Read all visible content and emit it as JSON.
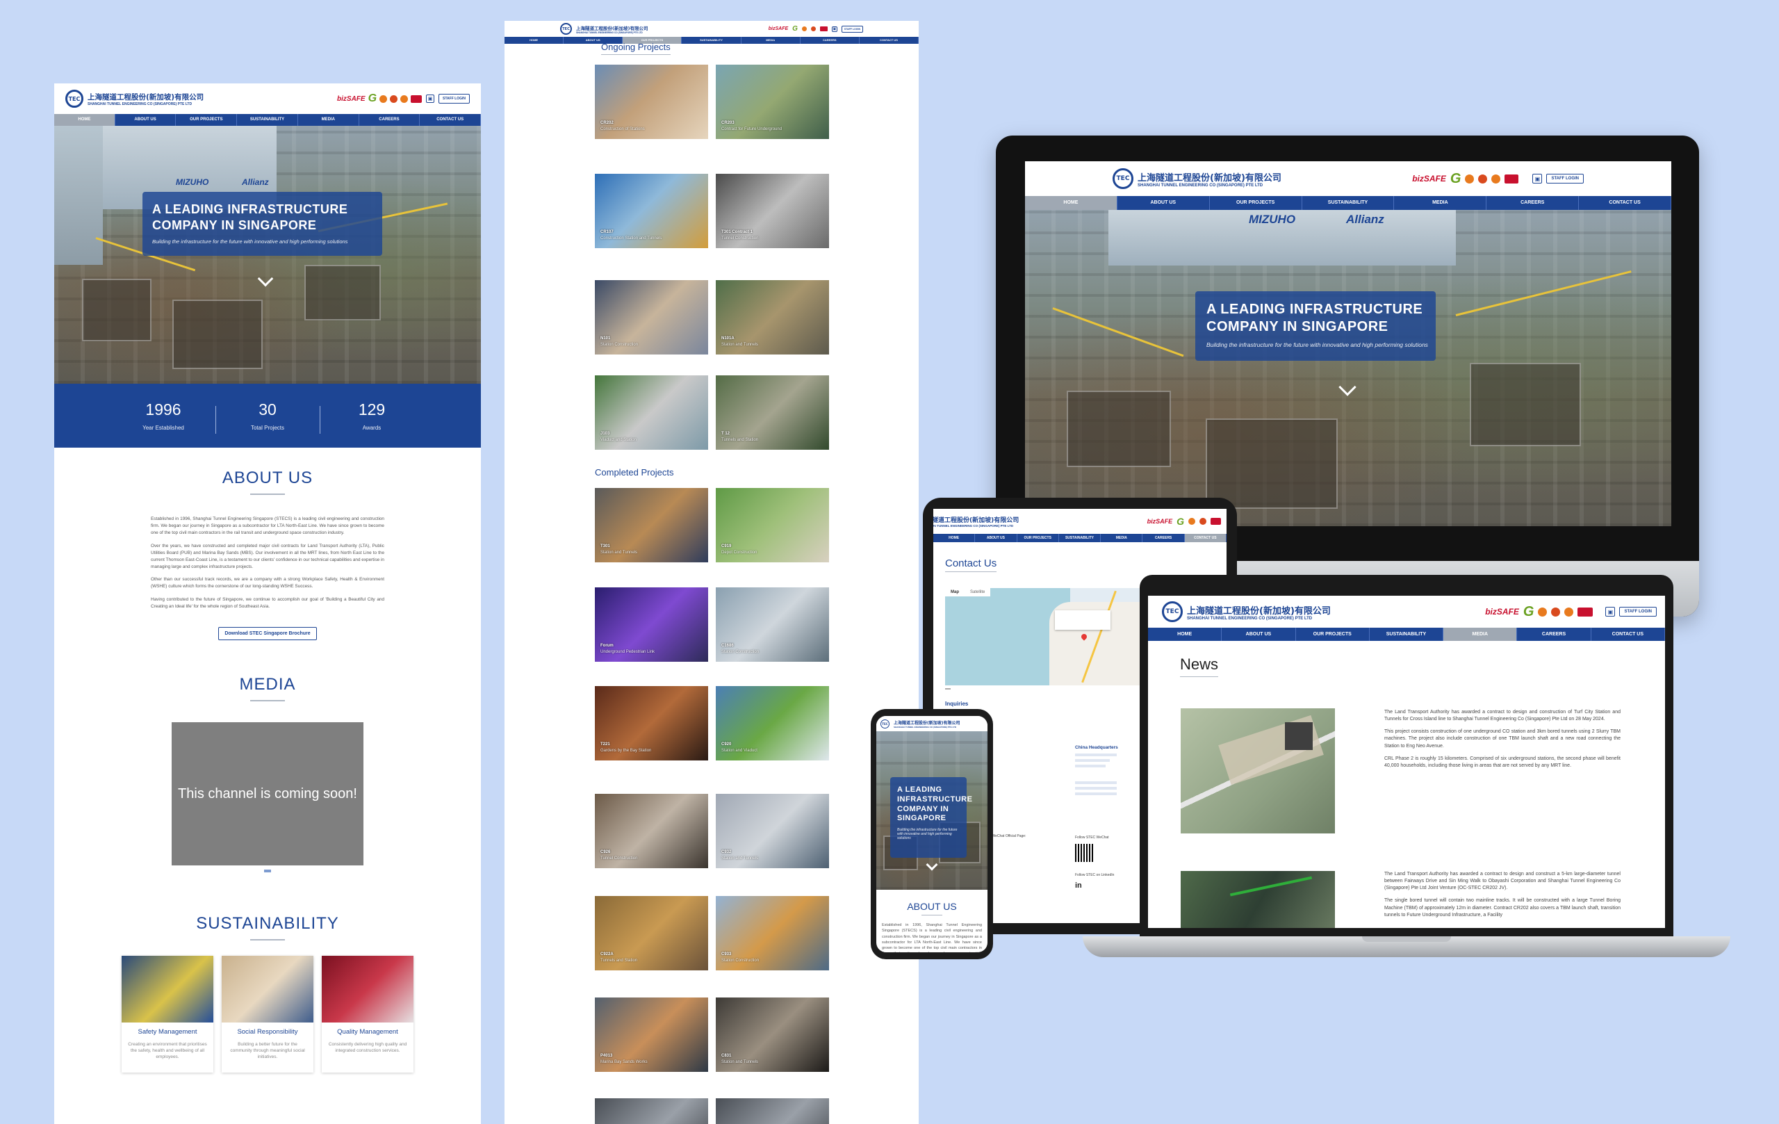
{
  "brand": {
    "logo_mark": "TEC",
    "name_cn": "上海隧道工程股份(新加坡)有限公司",
    "name_en": "SHANGHAI TUNNEL ENGINEERING CO (SINGAPORE) PTE LTD",
    "bizsafe": "bizSAFE",
    "staff_login": "STAFF LOGIN"
  },
  "nav": [
    "HOME",
    "ABOUT US",
    "OUR PROJECTS",
    "SUSTAINABILITY",
    "MEDIA",
    "CAREERS",
    "CONTACT US"
  ],
  "hero": {
    "title_line1": "A LEADING INFRASTRUCTURE",
    "title_line2": "COMPANY IN SINGAPORE",
    "subtitle": "Building the infrastructure for the future with innovative and high performing solutions",
    "signs": [
      "MIZUHO",
      "Allianz"
    ]
  },
  "stats": [
    {
      "value": "1996",
      "label": "Year Established"
    },
    {
      "value": "30",
      "label": "Total Projects"
    },
    {
      "value": "129",
      "label": "Awards"
    }
  ],
  "about": {
    "title": "ABOUT US",
    "paragraphs": [
      "Established in 1996, Shanghai Tunnel Engineering Singapore (STECS) is a leading civil engineering and construction firm. We began our journey in Singapore as a subcontractor for LTA North-East Line. We have since grown to become one of the top civil main contractors in the rail transit and underground space construction industry.",
      "Over the years, we have constructed and completed major civil contracts for Land Transport Authority (LTA), Public Utilities Board (PUB) and Marina Bay Sands (MBS). Our involvement in all the MRT lines, from North East Line to the current Thomson East-Coast Line, is a testament to our clients' confidence in our technical capabilities and expertise in managing large and complex infrastructure projects.",
      "Other than our successful track records, we are a company with a strong Workplace Safety, Health & Environment (WSHE) culture which forms the cornerstone of our long-standing WSHE Success.",
      "Having contributed to the future of Singapore, we continue to accomplish our goal of 'Building a Beautiful City and Creating an Ideal life' for the whole region of Southeast Asia."
    ],
    "brochure": "Download STEC Singapore Brochure"
  },
  "media": {
    "title": "MEDIA",
    "placeholder": "This channel is coming soon!"
  },
  "sustainability": {
    "title": "SUSTAINABILITY",
    "cards": [
      {
        "title": "Safety Management",
        "desc": "Creating an environment that prioritises the safety, health and wellbeing of all employees."
      },
      {
        "title": "Social Responsibility",
        "desc": "Building a better future for the community through meaningful social initiatives."
      },
      {
        "title": "Quality Management",
        "desc": "Consistently delivering high quality and integrated construction services."
      }
    ]
  },
  "projects": {
    "ongoing_title": "Ongoing Projects",
    "completed_title": "Completed Projects",
    "ongoing": [
      {
        "code": "CR202",
        "name": "Construction of Stations"
      },
      {
        "code": "CR203",
        "name": "Contract for Future Underground"
      },
      {
        "code": "CR107",
        "name": "Construction Station and Tunnels"
      },
      {
        "code": "T301 Contract 1",
        "name": "Tunnel Construction"
      },
      {
        "code": "N101",
        "name": "Station Construction"
      },
      {
        "code": "N101A",
        "name": "Station and Tunnels"
      },
      {
        "code": "J103",
        "name": "Viaduct and Station"
      },
      {
        "code": "T 12",
        "name": "Tunnels and Station"
      }
    ],
    "completed": [
      {
        "code": "T301",
        "name": "Station and Tunnels"
      },
      {
        "code": "C919",
        "name": "Depot Construction"
      },
      {
        "code": "Forum",
        "name": "Underground Pedestrian Link"
      },
      {
        "code": "C1686",
        "name": "Station Construction"
      },
      {
        "code": "T221",
        "name": "Gardens by the Bay Station"
      },
      {
        "code": "C920",
        "name": "Station and Viaduct"
      },
      {
        "code": "C926",
        "name": "Tunnel Construction"
      },
      {
        "code": "C932",
        "name": "Station and Tunnels"
      },
      {
        "code": "C922A",
        "name": "Tunnels and Station"
      },
      {
        "code": "C933",
        "name": "Station Construction"
      },
      {
        "code": "P4013",
        "name": "Marina Bay Sands Works"
      },
      {
        "code": "C831",
        "name": "Station and Tunnels"
      }
    ]
  },
  "contact": {
    "title": "Contact Us",
    "map_tabs": [
      "Map",
      "Satellite"
    ],
    "inquiries": "Inquiries",
    "china_hq": "China Headquarters",
    "follow_wechat": "Follow STEC WeChat",
    "follow_in": "Follow STEC on LinkedIn",
    "wechat_official": "Follow our WeChat Official Page:"
  },
  "news": {
    "title": "News",
    "items": [
      {
        "paragraphs": [
          "The Land Transport Authority has awarded a contract to design and construction of Turf City Station and Tunnels for Cross Island line to Shanghai Tunnel Engineering Co (Singapore) Pte Ltd on 28 May 2024.",
          "This project consists construction of one underground CO station and 3km bored tunnels using 2 Slurry TBM machines. The project also include construction of one TBM launch shaft and a new road connecting the Station to Eng Neo Avenue.",
          "CRL Phase 2 is roughly 15 kilometers. Comprised of six underground stations, the second phase will benefit 40,000 households, including those living in areas that are not served by any MRT line."
        ]
      },
      {
        "paragraphs": [
          "The Land Transport Authority has awarded a contract to design and construct a 5-km large-diameter tunnel between Fairways Drive and Sin Ming Walk to Obayashi Corporation and Shanghai Tunnel Engineering Co (Singapore) Pte Ltd Joint Venture (OC-STEC CR202 JV).",
          "The single bored tunnel will contain two mainline tracks. It will be constructed with a large Tunnel Boring Machine (TBM) of approximately 12m in diameter. Contract CR202 also covers a TBM launch shaft, transition tunnels to Future Underground Infrastructure, a Facility"
        ]
      }
    ]
  },
  "colors": {
    "primary": "#1d4594",
    "background": "#c7d9f7",
    "active_nav": "#9fa8b3"
  }
}
